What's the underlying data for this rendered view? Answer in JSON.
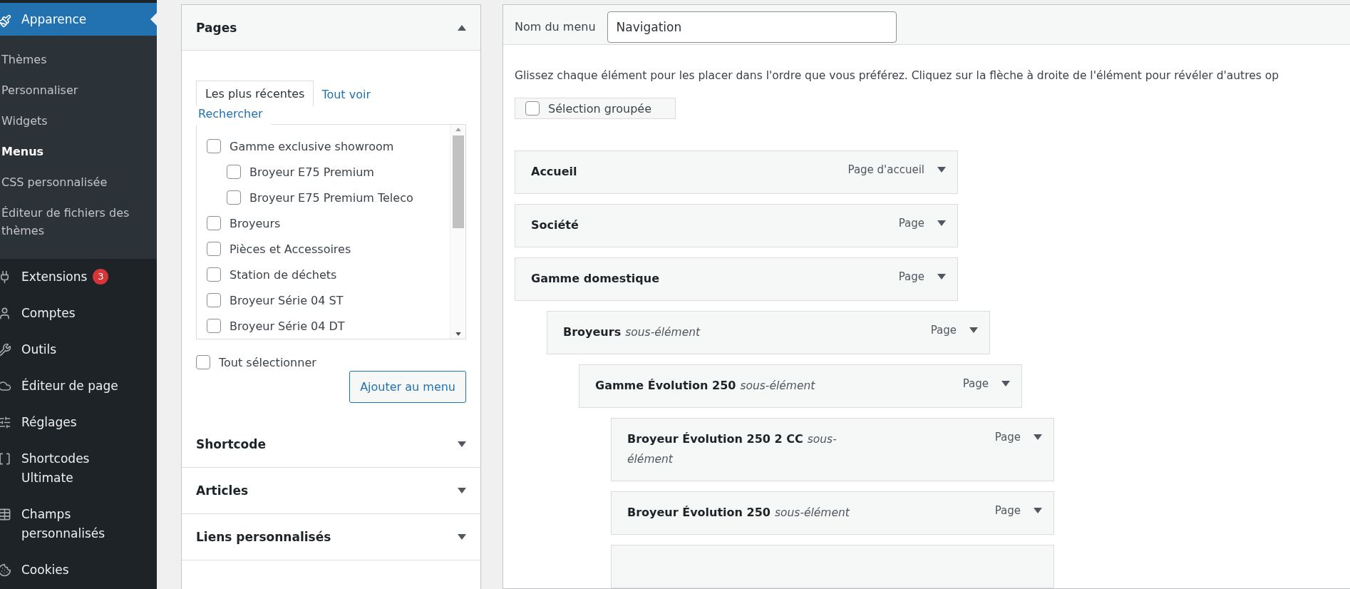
{
  "sidebar": {
    "current": {
      "label": "Apparence",
      "selected": true
    },
    "submenu": [
      {
        "label": "Thèmes",
        "selected": false
      },
      {
        "label": "Personnaliser",
        "selected": false
      },
      {
        "label": "Widgets",
        "selected": false
      },
      {
        "label": "Menus",
        "selected": true
      },
      {
        "label": "CSS personnalisée",
        "selected": false
      },
      {
        "label": "Éditeur de fichiers des thèmes",
        "selected": false
      }
    ],
    "items": [
      {
        "label": "Extensions",
        "badge": "3"
      },
      {
        "label": "Comptes"
      },
      {
        "label": "Outils"
      },
      {
        "label": "Éditeur de page"
      },
      {
        "label": "Réglages"
      },
      {
        "label": "Shortcodes Ultimate"
      },
      {
        "label": "Champs personnalisés"
      },
      {
        "label": "Cookies"
      }
    ]
  },
  "pages_box": {
    "title": "Pages",
    "expanded": true,
    "tabs": [
      {
        "label": "Les plus récentes",
        "selected": true
      },
      {
        "label": "Tout voir",
        "selected": false
      },
      {
        "label": "Rechercher",
        "selected": false
      }
    ],
    "pages": [
      {
        "label": "Gamme exclusive showroom",
        "checked": false,
        "children": [
          {
            "label": "Broyeur E75 Premium",
            "checked": false
          },
          {
            "label": "Broyeur E75 Premium Teleco",
            "checked": false
          }
        ]
      },
      {
        "label": "Broyeurs",
        "checked": false
      },
      {
        "label": "Pièces et Accessoires",
        "checked": false
      },
      {
        "label": "Station de déchets",
        "checked": false
      },
      {
        "label": "Broyeur Série 04 ST",
        "checked": false
      },
      {
        "label": "Broyeur Série 04 DT",
        "checked": false
      }
    ],
    "select_all": {
      "label": "Tout sélectionner",
      "checked": false
    },
    "add_button": "Ajouter au menu"
  },
  "sections": [
    {
      "title": "Shortcode",
      "expanded": false
    },
    {
      "title": "Articles",
      "expanded": false
    },
    {
      "title": "Liens personnalisés",
      "expanded": false
    }
  ],
  "menu_editor": {
    "name_label": "Nom du menu",
    "name_value": "Navigation",
    "instructions": "Glissez chaque élément pour les placer dans l'ordre que vous préférez. Cliquez sur la flèche à droite de l'élément pour révéler d'autres op",
    "bulk_select": {
      "label": "Sélection groupée",
      "checked": false
    },
    "items": [
      {
        "title": "Accueil",
        "type": "Page d'accueil"
      },
      {
        "title": "Société",
        "type": "Page"
      },
      {
        "title": "Gamme domestique",
        "type": "Page",
        "children": [
          {
            "title": "Broyeurs",
            "sub": "sous-élément",
            "type": "Page",
            "children": [
              {
                "title": "Gamme Évolution 250",
                "sub": "sous-élément",
                "type": "Page",
                "children": [
                  {
                    "title": "Broyeur Évolution 250 2 CC",
                    "sub": "sous-élément",
                    "type": "Page"
                  },
                  {
                    "title": "Broyeur Évolution 250",
                    "sub": "sous-élément",
                    "type": "Page"
                  }
                ]
              }
            ]
          }
        ]
      }
    ]
  }
}
